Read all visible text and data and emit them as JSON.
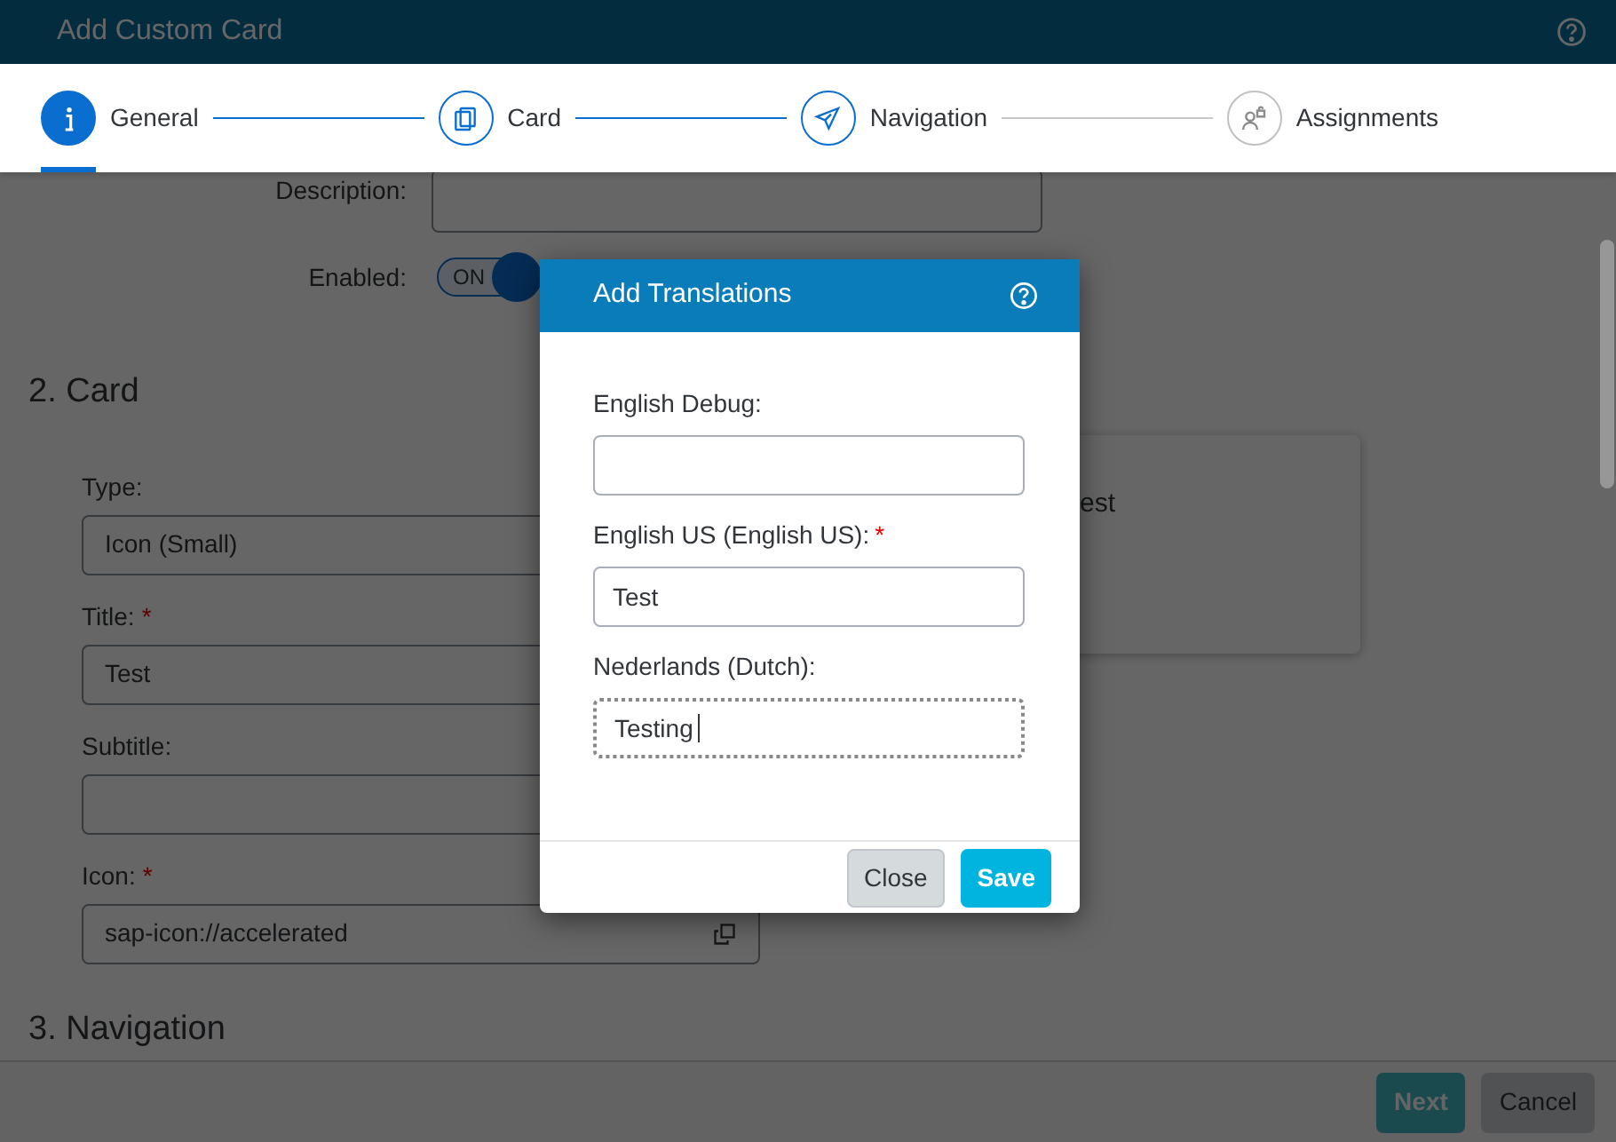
{
  "window": {
    "title": "Add Custom Card"
  },
  "steps": [
    {
      "label": "General",
      "kind": "info",
      "selected": true,
      "reached": true
    },
    {
      "label": "Card",
      "kind": "cards",
      "selected": false,
      "reached": true
    },
    {
      "label": "Navigation",
      "kind": "send",
      "selected": false,
      "reached": true
    },
    {
      "label": "Assignments",
      "kind": "person-lock",
      "selected": false,
      "reached": false
    }
  ],
  "general": {
    "description_label": "Description:",
    "enabled_label": "Enabled:",
    "enabled": {
      "on": true,
      "text": "ON"
    }
  },
  "card_section": {
    "title": "2. Card",
    "fields": [
      {
        "label": "Type:",
        "value": "Icon (Small)",
        "kind": "text"
      },
      {
        "label": "Title:",
        "required_mark": "*",
        "value": "Test",
        "kind": "text"
      },
      {
        "label": "Subtitle:",
        "kind": "text"
      },
      {
        "label": "Icon:",
        "required_mark": "*",
        "value": "sap-icon://accelerated",
        "kind": "value-help"
      }
    ],
    "preview_text": "est"
  },
  "next_section": {
    "title": "3. Navigation"
  },
  "footer": {
    "buttons": [
      {
        "label": "Next",
        "kind": "primary",
        "disabled": true
      },
      {
        "label": "Cancel",
        "kind": "secondary",
        "disabled": false
      }
    ]
  },
  "dialog": {
    "title": "Add Translations",
    "fields": [
      {
        "label": "English Debug:",
        "focused": false
      },
      {
        "label": "English US (English US):",
        "required_mark": "*",
        "value": "Test",
        "focused": false
      },
      {
        "label": "Nederlands (Dutch):",
        "value": "Testing",
        "focused": true
      }
    ],
    "buttons": [
      {
        "label": "Close",
        "kind": "secondary"
      },
      {
        "label": "Save",
        "kind": "primary"
      }
    ]
  }
}
